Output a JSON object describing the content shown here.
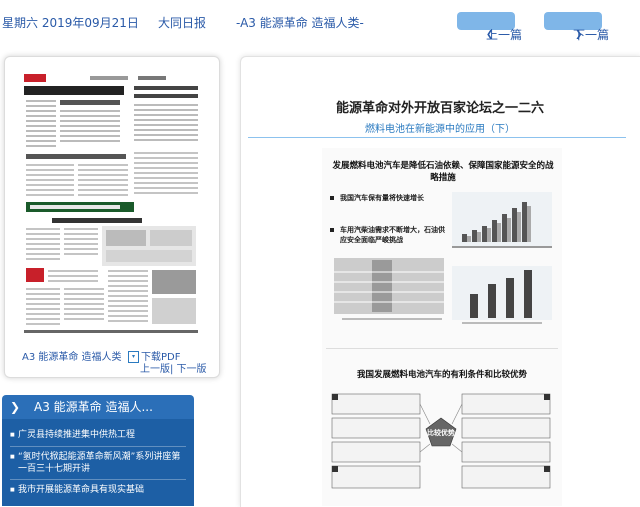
{
  "topbar": {
    "date": "星期六 2019年09月21日",
    "paper": "大同日报",
    "page": "-A3 能源革命 造福人类-",
    "prev": "上一篇",
    "next": "下一篇"
  },
  "thumbnail": {
    "caption": "A3 能源革命 造福人类",
    "pdf": "下载PDF",
    "pager": "上一版| 下一版",
    "headline": "广灵县持续推进集中供热工程"
  },
  "article": {
    "title": "能源革命对外开放百家论坛之一二六",
    "subtitle": "燃料电池在新能源中的应用（下）",
    "figure1_title": "发展燃料电池汽车是降低石油依赖、保障国家能源安全的战略措施",
    "figure1_bullets": [
      "我国汽车保有量将快速增长",
      "车用汽柴油需求不断增大，石油供应安全面临严峻挑战"
    ],
    "figure2_title": "我国发展燃料电池汽车的有利条件和比较优势",
    "figure2_center": "比较优势"
  },
  "sidebar": {
    "section": "A3  能源革命 造福人...",
    "items": [
      "广灵县持续推进集中供热工程",
      "“氢时代掀起能源革命新风潮”系列讲座第一百三十七期开讲",
      "我市开展能源革命具有现实基础"
    ]
  },
  "colors": {
    "accent": "#2b6fb8",
    "nav_button": "#7fb6e8",
    "link": "#2a5aa8"
  }
}
